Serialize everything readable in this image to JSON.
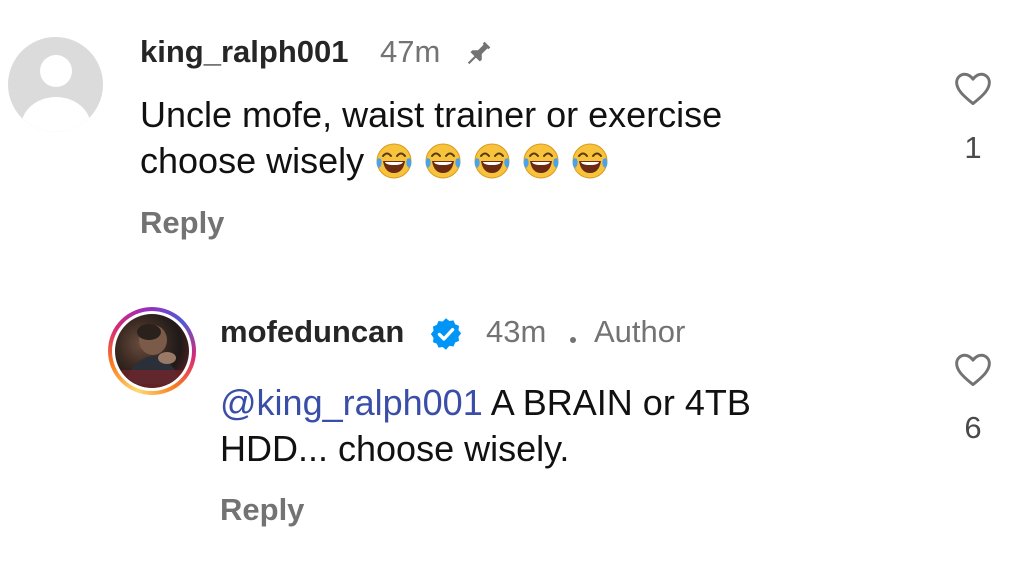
{
  "comments": [
    {
      "username": "king_ralph001",
      "time": "47m",
      "pinned": true,
      "text": "Uncle mofe, waist trainer or exercise choose wisely",
      "emoji_count": 5,
      "emoji_name": "face-with-tears-of-joy",
      "reply_label": "Reply",
      "likes": "1"
    },
    {
      "username": "mofeduncan",
      "verified": true,
      "time": "43m",
      "role": "Author",
      "mention": "@king_ralph001",
      "text": "A BRAIN or 4TB HDD... choose wisely.",
      "reply_label": "Reply",
      "likes": "6"
    }
  ],
  "colors": {
    "mention": "#3a4ea8",
    "verified": "#0095f6",
    "muted": "#737373"
  }
}
